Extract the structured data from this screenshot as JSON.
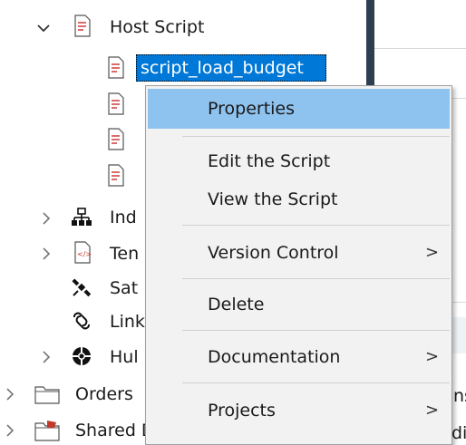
{
  "tree": {
    "host_script": {
      "label": "Host Script",
      "expanded": true
    },
    "scripts": [
      {
        "label": "script_load_budget",
        "selected": true
      },
      {
        "label": ""
      },
      {
        "label": ""
      },
      {
        "label": ""
      }
    ],
    "nodes": [
      {
        "label": "Ind",
        "icon": "index-icon"
      },
      {
        "label": "Ten",
        "icon": "template-icon"
      },
      {
        "label": "Sat",
        "icon": "satellite-icon"
      },
      {
        "label": "Link",
        "icon": "link-icon"
      },
      {
        "label": "Hul",
        "icon": "hub-icon"
      }
    ],
    "orders": {
      "label": "Orders",
      "icon": "folder-icon"
    },
    "shared": {
      "label": "Shared Dimensions",
      "icon": "folder-red-icon"
    }
  },
  "right_panel": {
    "fragment_1": "ns",
    "fragment_2": "dim"
  },
  "context_menu": {
    "items": [
      {
        "label": "Properties",
        "highlighted": true,
        "submenu": false
      },
      {
        "label": "Edit the Script",
        "submenu": false
      },
      {
        "label": "View the Script",
        "submenu": false
      },
      {
        "label": "Version Control",
        "submenu": true,
        "arrow": ">"
      },
      {
        "label": "Delete",
        "submenu": false
      },
      {
        "label": "Documentation",
        "submenu": true,
        "arrow": ">"
      },
      {
        "label": "Projects",
        "submenu": true,
        "arrow": ">"
      }
    ]
  },
  "colors": {
    "selection": "#0078d7",
    "menu_highlight": "#8fc3ef",
    "menu_bg": "#f2f2f2",
    "divider": "#2c3e50"
  }
}
